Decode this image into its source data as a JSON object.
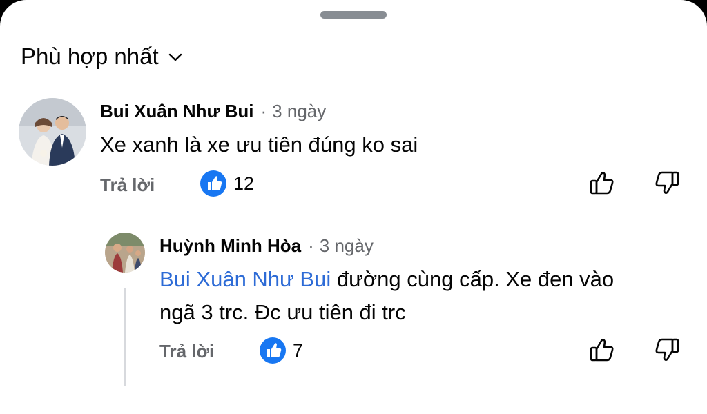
{
  "sort": {
    "label": "Phù hợp nhất",
    "icon": "chevron-down-icon"
  },
  "comments": [
    {
      "author": "Bui Xuân Như Bui",
      "separator": "·",
      "time": "3 ngày",
      "text": "Xe xanh là xe ưu tiên đúng ko sai",
      "reply_label": "Trả lời",
      "like_count": "12"
    }
  ],
  "reply": {
    "author": "Huỳnh Minh Hòa",
    "separator": "·",
    "time": "3 ngày",
    "mention": "Bui Xuân Như Bui",
    "text_line1": " đường cùng cấp. Xe đen vào",
    "text_line2": "ngã 3 trc. Đc ưu tiên đi trc",
    "reply_label": "Trả lời",
    "like_count": "7"
  },
  "colors": {
    "like_blue": "#1877f2",
    "mention_blue": "#2d6bd6",
    "meta_gray": "#65676b"
  }
}
